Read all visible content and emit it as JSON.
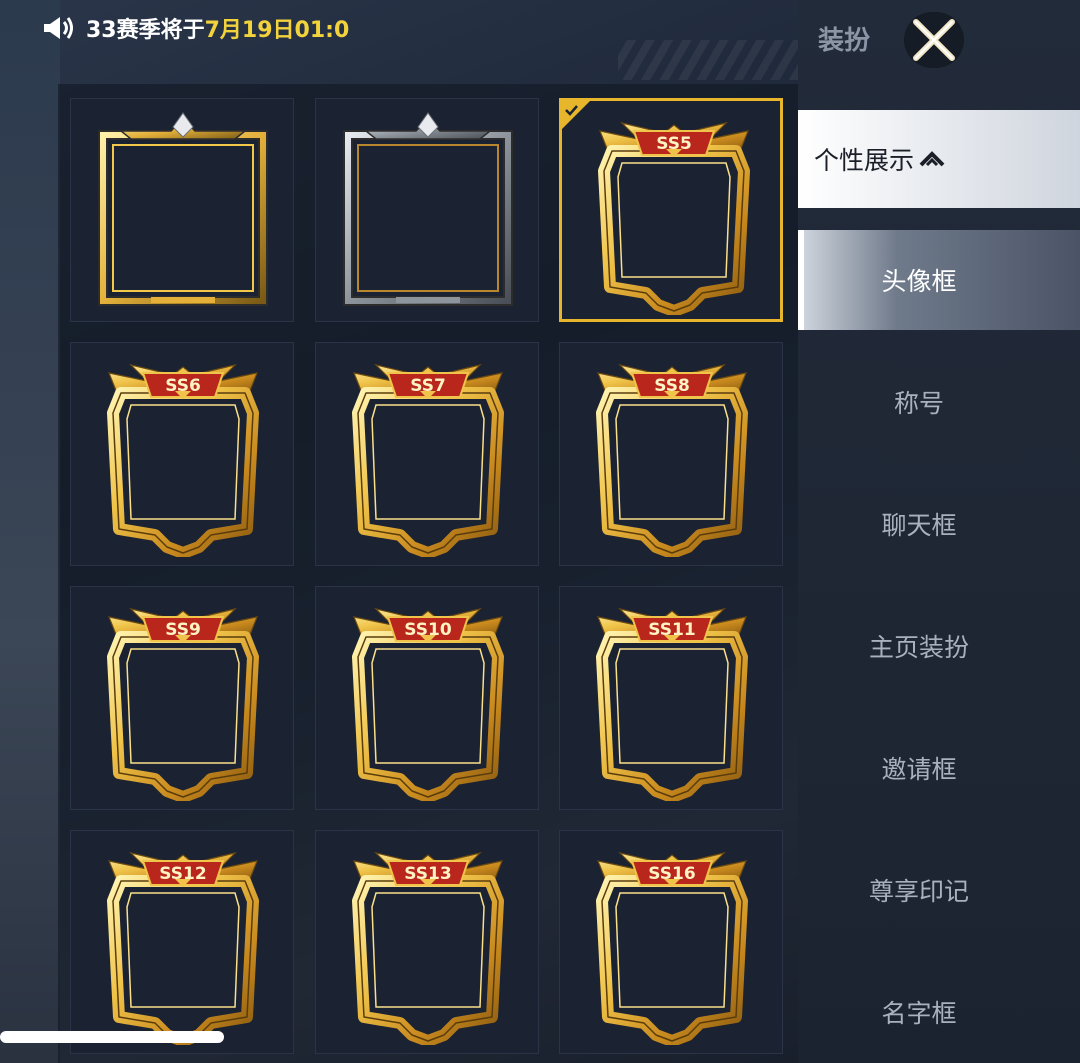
{
  "notice": {
    "prefix": "33赛季将于",
    "highlight": "7月19日01:0",
    "icon": "speaker-icon"
  },
  "sidebar": {
    "title": "装扮",
    "close_icon": "close-icon",
    "category": "个性展示",
    "items": [
      {
        "label": "头像框",
        "active": true
      },
      {
        "label": "称号",
        "active": false
      },
      {
        "label": "聊天框",
        "active": false
      },
      {
        "label": "主页装扮",
        "active": false
      },
      {
        "label": "邀请框",
        "active": false
      },
      {
        "label": "尊享印记",
        "active": false
      },
      {
        "label": "名字框",
        "active": false
      }
    ]
  },
  "frames": [
    {
      "label": "",
      "style": "gold-plain"
    },
    {
      "label": "",
      "style": "silver-plain"
    },
    {
      "label": "SS5",
      "style": "winged",
      "selected": true
    },
    {
      "label": "SS6",
      "style": "winged"
    },
    {
      "label": "SS7",
      "style": "winged"
    },
    {
      "label": "SS8",
      "style": "winged"
    },
    {
      "label": "SS9",
      "style": "winged"
    },
    {
      "label": "SS10",
      "style": "winged"
    },
    {
      "label": "SS11",
      "style": "winged"
    },
    {
      "label": "SS12",
      "style": "winged"
    },
    {
      "label": "SS13",
      "style": "winged"
    },
    {
      "label": "SS16",
      "style": "winged"
    }
  ],
  "colors": {
    "accent": "#e8b62c",
    "highlight_text": "#f3d33c",
    "gold": "#e6b43a",
    "silver": "#9aa0a8"
  }
}
